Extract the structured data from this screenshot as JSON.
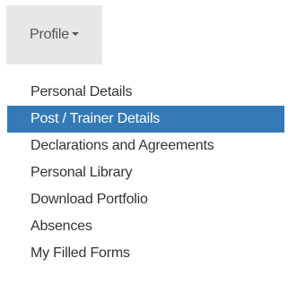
{
  "profile_menu": {
    "toggle_label": "Profile",
    "items": [
      {
        "label": "Personal Details"
      },
      {
        "label": "Post / Trainer Details"
      },
      {
        "label": "Declarations and Agreements"
      },
      {
        "label": "Personal Library"
      },
      {
        "label": "Download Portfolio"
      },
      {
        "label": "Absences"
      },
      {
        "label": "My Filled Forms"
      }
    ],
    "active_index": 1,
    "colors": {
      "toggle_bg": "#e7e7e7",
      "active_bg": "#337ab7",
      "active_text": "#ffffff",
      "text": "#333333"
    },
    "icons": {
      "toggle_caret": "caret-down-icon"
    }
  }
}
